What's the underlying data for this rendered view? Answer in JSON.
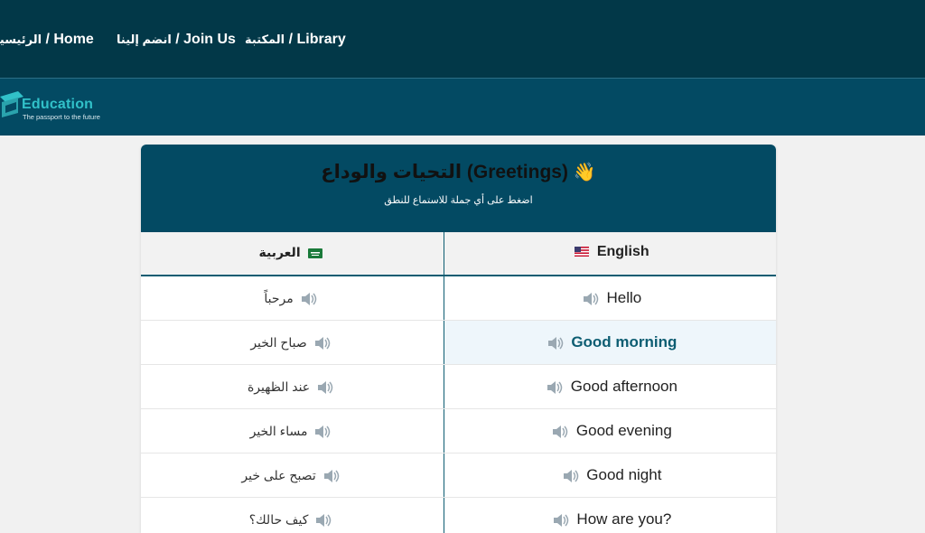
{
  "nav": {
    "home": {
      "en": "Home",
      "ar": "الرئيسية"
    },
    "join": {
      "en": "Join Us",
      "ar": "انضم إلينا"
    },
    "library": {
      "en": "Library",
      "ar": "المكتبة"
    },
    "separator": " / "
  },
  "brand": {
    "name": "Education",
    "tagline": "The passport to the future"
  },
  "card": {
    "emoji": "👋",
    "title": "التحيات والوداع (Greetings)",
    "subtitle": "اضغط على أي جملة للاستماع للنطق"
  },
  "table": {
    "headers": {
      "arabic": "العربية",
      "english": "English"
    },
    "rows": [
      {
        "en": "Hello",
        "ar": "مرحباً"
      },
      {
        "en": "Good morning",
        "ar": "صباح الخير"
      },
      {
        "en": "Good afternoon",
        "ar": "عند الظهيرة"
      },
      {
        "en": "Good evening",
        "ar": "مساء الخير"
      },
      {
        "en": "Good night",
        "ar": "تصبح على خير"
      },
      {
        "en": "How are you?",
        "ar": "كيف حالك؟"
      }
    ]
  },
  "colors": {
    "nav_bg": "#023848",
    "brand_bg": "#034a63",
    "accent": "#0d5d72",
    "logo": "#31c1c9"
  }
}
